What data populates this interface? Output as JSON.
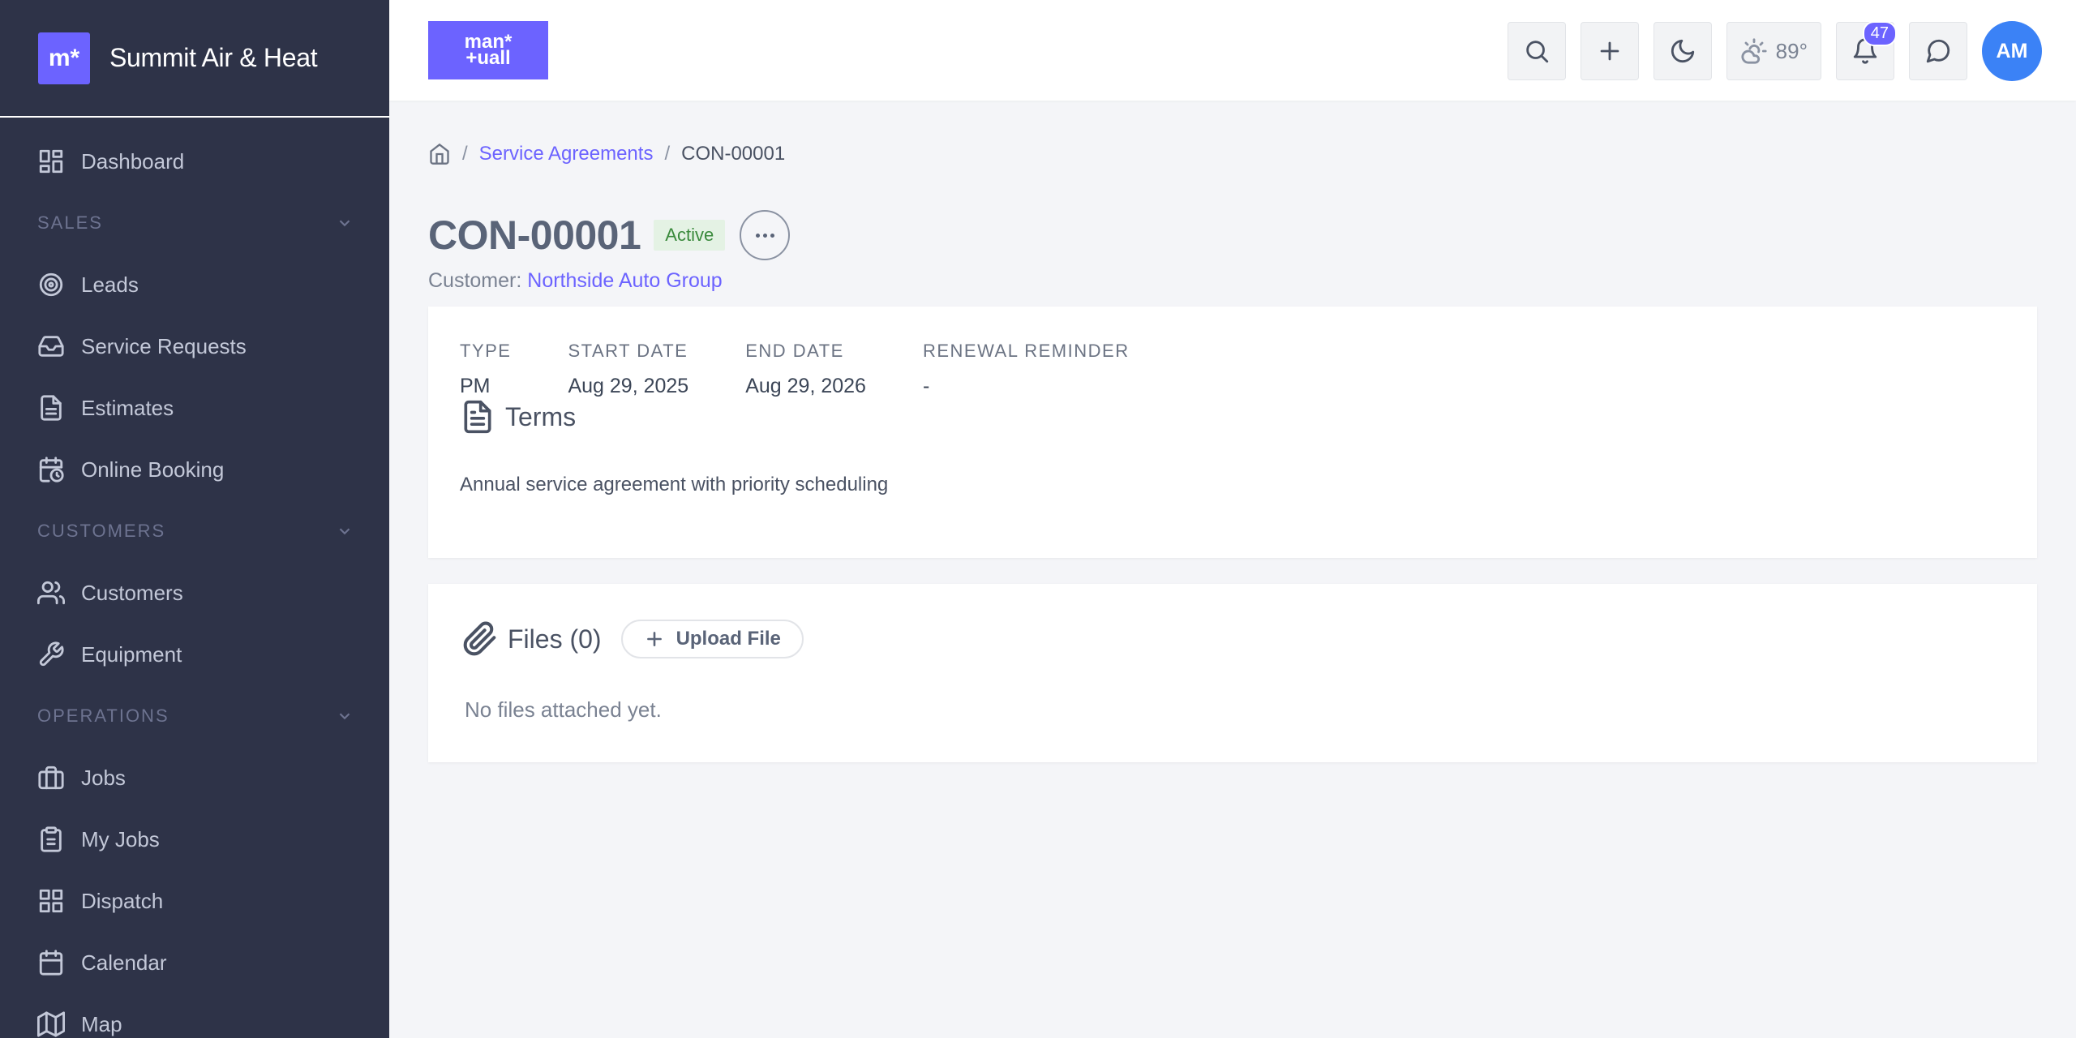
{
  "brand": {
    "logo_text": "m*",
    "name": "Summit Air & Heat"
  },
  "sidebar": {
    "items": [
      {
        "label": "Dashboard",
        "icon": "dashboard-icon"
      },
      {
        "section": "SALES"
      },
      {
        "label": "Leads",
        "icon": "target-icon"
      },
      {
        "label": "Service Requests",
        "icon": "inbox-icon"
      },
      {
        "label": "Estimates",
        "icon": "document-icon"
      },
      {
        "label": "Online Booking",
        "icon": "calendar-clock-icon"
      },
      {
        "section": "CUSTOMERS"
      },
      {
        "label": "Customers",
        "icon": "users-icon"
      },
      {
        "label": "Equipment",
        "icon": "wrench-icon"
      },
      {
        "section": "OPERATIONS"
      },
      {
        "label": "Jobs",
        "icon": "briefcase-icon"
      },
      {
        "label": "My Jobs",
        "icon": "clipboard-icon"
      },
      {
        "label": "Dispatch",
        "icon": "grid-icon"
      },
      {
        "label": "Calendar",
        "icon": "calendar-icon"
      },
      {
        "label": "Map",
        "icon": "map-icon"
      }
    ]
  },
  "header": {
    "logo_line1": "man*",
    "logo_line2": "+uall",
    "weather_temp": "89°",
    "notifications_count": "47",
    "avatar_initials": "AM"
  },
  "breadcrumb": {
    "parent": "Service Agreements",
    "current": "CON-00001"
  },
  "agreement": {
    "title": "CON-00001",
    "status": "Active",
    "customer_prefix": "Customer:",
    "customer_name": "Northside Auto Group",
    "fields": [
      {
        "label": "TYPE",
        "value": "PM"
      },
      {
        "label": "START DATE",
        "value": "Aug 29, 2025"
      },
      {
        "label": "END DATE",
        "value": "Aug 29, 2026"
      },
      {
        "label": "RENEWAL REMINDER",
        "value": "-"
      }
    ],
    "terms_title": "Terms",
    "terms_text": "Annual service agreement with priority scheduling"
  },
  "files": {
    "title": "Files (0)",
    "upload_label": "Upload File",
    "empty_text": "No files attached yet."
  },
  "colors": {
    "accent": "#6c63ff",
    "sidebar_bg": "#2e3348",
    "avatar": "#3b82f6",
    "status_green": "#3a8a3c"
  }
}
